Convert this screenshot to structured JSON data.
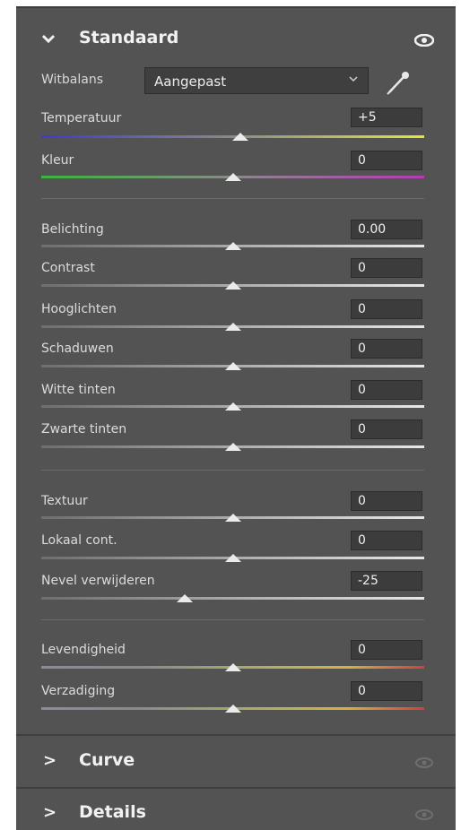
{
  "sections": {
    "standaard": {
      "title": "Standaard",
      "chevron": "⌄"
    },
    "curve": {
      "title": "Curve",
      "chevron": ">"
    },
    "details": {
      "title": "Details",
      "chevron": ">"
    }
  },
  "white_balance": {
    "label": "Witbalans",
    "value": "Aangepast",
    "dropdown_icon": "chevron-down-icon",
    "picker_icon": "eyedropper-icon"
  },
  "sliders": {
    "temperatuur": {
      "label": "Temperatuur",
      "value": "+5",
      "level": 0.52
    },
    "kleur": {
      "label": "Kleur",
      "value": "0",
      "level": 0.5
    },
    "belichting": {
      "label": "Belichting",
      "value": "0.00",
      "level": 0.5
    },
    "contrast": {
      "label": "Contrast",
      "value": "0",
      "level": 0.5
    },
    "hooglichten": {
      "label": "Hooglichten",
      "value": "0",
      "level": 0.5
    },
    "schaduwen": {
      "label": "Schaduwen",
      "value": "0",
      "level": 0.5
    },
    "witte_tinten": {
      "label": "Witte tinten",
      "value": "0",
      "level": 0.5
    },
    "zwarte_tinten": {
      "label": "Zwarte tinten",
      "value": "0",
      "level": 0.5
    },
    "textuur": {
      "label": "Textuur",
      "value": "0",
      "level": 0.5
    },
    "lokaal_cont": {
      "label": "Lokaal cont.",
      "value": "0",
      "level": 0.5
    },
    "nevel": {
      "label": "Nevel verwijderen",
      "value": "-25",
      "level": 0.375
    },
    "levendigheid": {
      "label": "Levendigheid",
      "value": "0",
      "level": 0.5
    },
    "verzadiging": {
      "label": "Verzadiging",
      "value": "0",
      "level": 0.5
    }
  },
  "colors": {
    "panel": "#535353",
    "temp_start": "#3a3ad6",
    "temp_end": "#e6e63a",
    "tint_start": "#3cb43c",
    "tint_end": "#b43cb4"
  }
}
